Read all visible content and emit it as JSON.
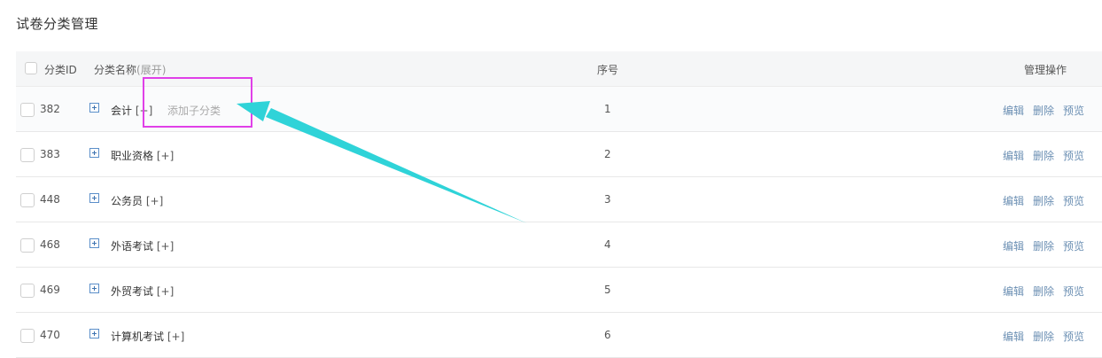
{
  "page": {
    "title": "试卷分类管理"
  },
  "table": {
    "headers": {
      "id": "分类ID",
      "name": "分类名称",
      "expand": "(展开)",
      "seq": "序号",
      "ops": "管理操作"
    },
    "rows": [
      {
        "id": "382",
        "name": "会计",
        "bracket": "[+]",
        "seq": "1"
      },
      {
        "id": "383",
        "name": "职业资格",
        "bracket": "[+]",
        "seq": "2"
      },
      {
        "id": "448",
        "name": "公务员",
        "bracket": "[+]",
        "seq": "3"
      },
      {
        "id": "468",
        "name": "外语考试",
        "bracket": "[+]",
        "seq": "4"
      },
      {
        "id": "469",
        "name": "外贸考试",
        "bracket": "[+]",
        "seq": "5"
      },
      {
        "id": "470",
        "name": "计算机考试",
        "bracket": "[+]",
        "seq": "6"
      }
    ],
    "ops": {
      "edit": "编辑",
      "delete": "删除",
      "preview": "预览"
    },
    "add_child_label": "添加子分类"
  },
  "annotation": {
    "box_color": "#e040e8",
    "arrow_color": "#2fd3d8"
  }
}
